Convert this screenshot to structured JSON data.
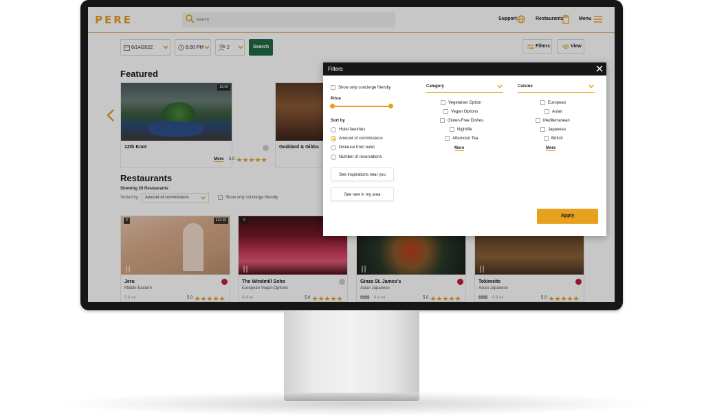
{
  "app": {
    "logo": "PERE"
  },
  "header": {
    "search_placeholder": "Search",
    "support_label": "Support",
    "restaurants_label": "Restaurants",
    "menu_label": "Menu"
  },
  "toolbar": {
    "date": "6/14/2022",
    "time": "6:00 PM",
    "guests": "2",
    "search_label": "Search",
    "filters_label": "Filters",
    "view_label": "View"
  },
  "featured": {
    "title": "Featured",
    "cards": [
      {
        "name": "12th Knot",
        "price": "£6.00",
        "more": "More",
        "rating": "5.0",
        "stars": 5
      },
      {
        "name": "Goddard & Gibbs"
      }
    ]
  },
  "restaurants": {
    "title": "Restaurants",
    "count_text": "Showing 20 Restaurants",
    "sorted_by_label": "Sorted by:",
    "sort_value": "Amount of commissions",
    "concierge_label": "Show only concierge friendly",
    "cards": [
      {
        "name": "Jeru",
        "sub": "Middle Eastern",
        "dist": "0.6 mi",
        "rating": "5.0",
        "stars": 5,
        "tag": "0",
        "price": "£13.40",
        "price_level": ""
      },
      {
        "name": "The Windmill Soho",
        "sub": "European  Vegan Options",
        "dist": "0.4 mi",
        "rating": "5.0",
        "stars": 5,
        "tag": "0",
        "price": "",
        "price_level": ""
      },
      {
        "name": "Ginza St. James's",
        "sub": "Asian  Japanese",
        "dist": "0.4 mi",
        "rating": "5.0",
        "stars": 5,
        "tag": "",
        "price": "",
        "price_level": "$$$$"
      },
      {
        "name": "Tokimeite",
        "sub": "Asian  Japanese",
        "dist": "0.6 mi",
        "rating": "5.0",
        "stars": 5,
        "tag": "",
        "price": "",
        "price_level": "$$$$"
      }
    ]
  },
  "filters": {
    "title": "Filters",
    "concierge_label": "Show only concierge friendly",
    "price_label": "Price",
    "sort_by_label": "Sort by",
    "sort_options": [
      "Hotel favorites",
      "Amount of commissions",
      "Distance from hotel",
      "Number of reservations"
    ],
    "sort_selected": "Amount of commissions",
    "inspirations_label": "See inspirations near you",
    "new_label": "See new in my area",
    "category": {
      "label": "Category",
      "options": [
        "Vegetarian Option",
        "Vegan Options",
        "Gluten-Free Dishes",
        "Nightlife",
        "Afternoon Tea"
      ],
      "more": "More"
    },
    "cuisine": {
      "label": "Cuisine",
      "options": [
        "European",
        "Asian",
        "Mediterranean",
        "Japanese",
        "British"
      ],
      "more": "More"
    },
    "apply_label": "Apply"
  },
  "colors": {
    "accent": "#e59f1f",
    "search_green": "#1f6b44",
    "dark": "#161616"
  }
}
